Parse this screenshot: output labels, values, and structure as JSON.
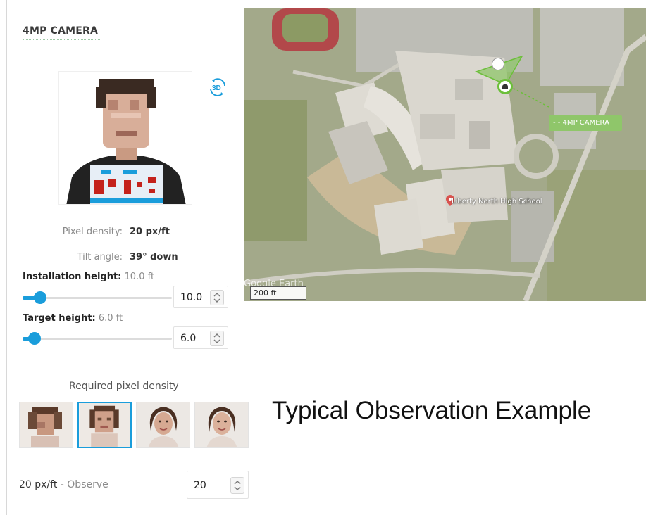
{
  "panel": {
    "title": "4MP CAMERA",
    "three_d_icon": "3d-rotate-icon",
    "pixel_density": {
      "label": "Pixel density:",
      "value": "20 px/ft"
    },
    "tilt_angle": {
      "label": "Tilt angle:",
      "value": "39° down"
    },
    "installation_height": {
      "label": "Installation height:",
      "value_text": "10.0 ft",
      "input_value": "10.0",
      "slider_level_percent": 12
    },
    "target_height": {
      "label": "Target height:",
      "value_text": "6.0 ft",
      "input_value": "6.0",
      "slider_level_percent": 8
    }
  },
  "map": {
    "camera_label": "- - 4MP CAMERA",
    "school_label": "Liberty North High School",
    "scale_label": "200 ft",
    "watermark": "Google Earth",
    "colors": {
      "coverage": "#8fc66a",
      "camera_marker": "#6cbf3a"
    }
  },
  "required_density": {
    "title": "Required pixel density",
    "selected_index": 1,
    "thumbnails": [
      "pixelated-face-low-icon",
      "pixelated-face-observe-icon",
      "face-recognize-icon",
      "face-identify-icon"
    ],
    "density_text": "20 px/ft",
    "separator": " - ",
    "mode": "Observe",
    "input_value": "20"
  },
  "headline": "Typical Observation Example",
  "colors": {
    "accent": "#1a9ddb"
  }
}
